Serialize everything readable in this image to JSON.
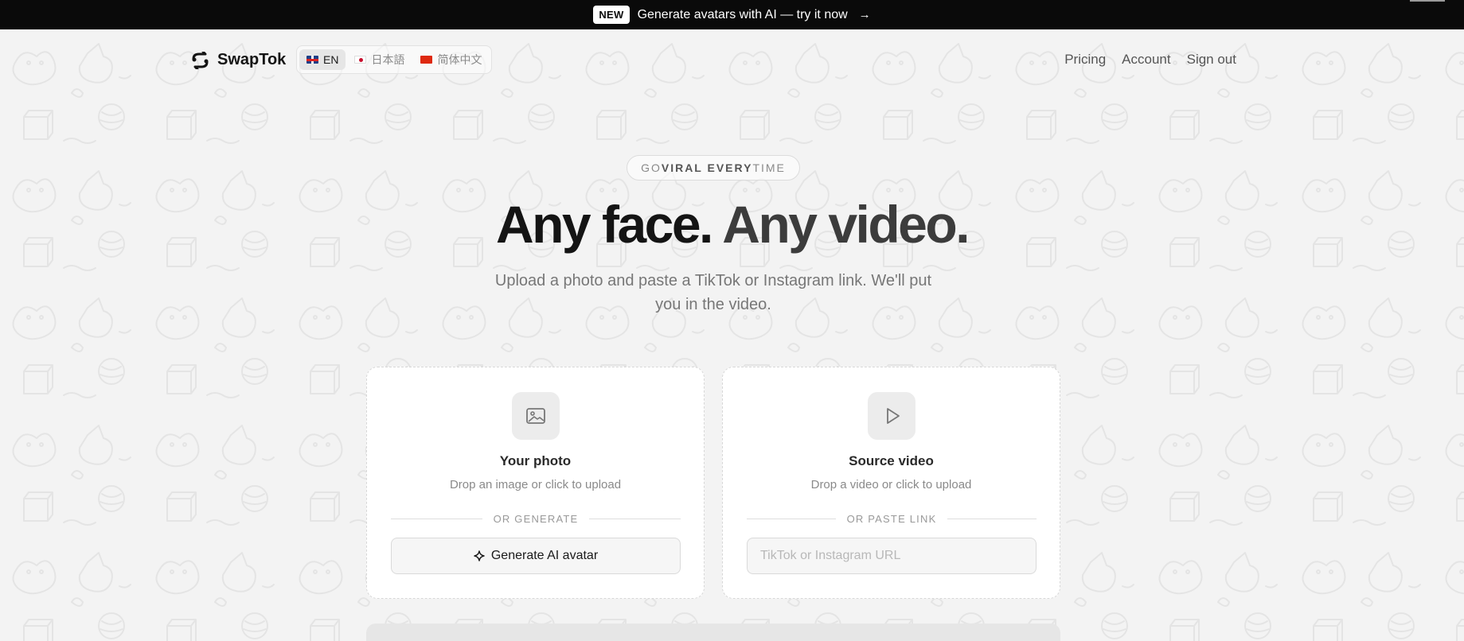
{
  "announcement": {
    "badge": "NEW",
    "text": "Generate avatars with AI — try it now",
    "arrow": "→"
  },
  "brand": {
    "name": "SwapTok",
    "icon": "swap-arrows-icon"
  },
  "languages": [
    {
      "code": "EN",
      "flag": "flag-uk-icon",
      "active": true
    },
    {
      "code": "日本語",
      "flag": "flag-jp-icon",
      "active": false
    },
    {
      "code": "简体中文",
      "flag": "flag-cn-icon",
      "active": false
    }
  ],
  "nav": {
    "pricing": "Pricing",
    "account": "Account",
    "sign_out": "Sign out"
  },
  "hero": {
    "eyebrow_pre": "GO ",
    "eyebrow_bold": "VIRAL EVERY",
    "eyebrow_post": " TIME",
    "headline_1": "Any face.",
    "headline_2": "Any video.",
    "subhead": "Upload a photo and paste a TikTok or Instagram link. We'll put you in the video."
  },
  "photo_card": {
    "icon": "image-icon",
    "title": "Your photo",
    "description": "Drop an image or click to upload",
    "divider": "OR GENERATE",
    "button_icon": "sparkle-icon",
    "button_label": "Generate AI avatar"
  },
  "video_card": {
    "icon": "play-icon",
    "title": "Source video",
    "description": "Drop a video or click to upload",
    "divider": "OR PASTE LINK",
    "input_value": "",
    "input_placeholder": "TikTok or Instagram URL"
  },
  "colors": {
    "announcement_bg": "#0a0a0a",
    "page_bg": "#f3f3f3",
    "card_bg": "#ffffff"
  }
}
